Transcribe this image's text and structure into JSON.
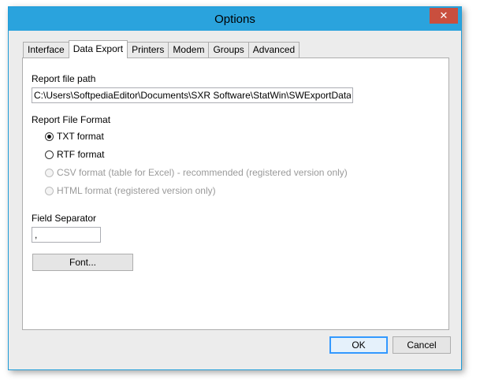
{
  "window": {
    "title": "Options",
    "close_glyph": "✕"
  },
  "tabs": [
    {
      "label": "Interface"
    },
    {
      "label": "Data Export"
    },
    {
      "label": "Printers"
    },
    {
      "label": "Modem"
    },
    {
      "label": "Groups"
    },
    {
      "label": "Advanced"
    }
  ],
  "export": {
    "path_label": "Report file path",
    "path_value": "C:\\Users\\SoftpediaEditor\\Documents\\SXR Software\\StatWin\\SWExportData\\",
    "format_label": "Report File Format",
    "formats": [
      {
        "label": "TXT format",
        "checked": true,
        "enabled": true
      },
      {
        "label": "RTF format",
        "checked": false,
        "enabled": true
      },
      {
        "label": "CSV format (table for Excel) - recommended (registered version only)",
        "checked": false,
        "enabled": false
      },
      {
        "label": "HTML format (registered version only)",
        "checked": false,
        "enabled": false
      }
    ],
    "separator_label": "Field Separator",
    "separator_value": ",",
    "font_button": "Font..."
  },
  "footer": {
    "ok": "OK",
    "cancel": "Cancel"
  }
}
